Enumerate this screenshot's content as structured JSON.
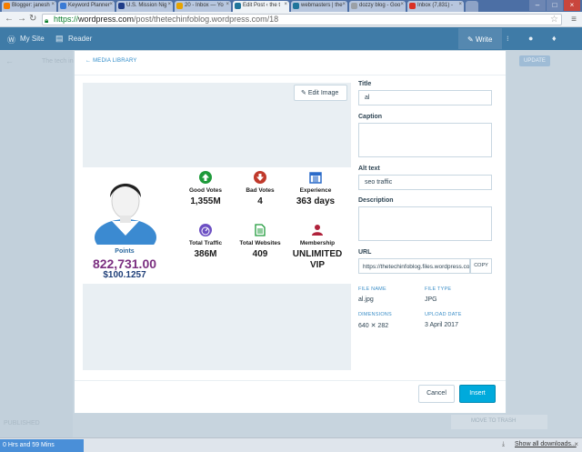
{
  "browser": {
    "tabs": [
      {
        "label": "Blogger: janesh",
        "color": "#f57d00",
        "active": false
      },
      {
        "label": "Keyword Planner",
        "color": "#3a7bd5",
        "active": false
      },
      {
        "label": "U.S. Mission Nig",
        "color": "#1f3c88",
        "active": false
      },
      {
        "label": "20 - Inbox — Yo",
        "color": "#e8a400",
        "active": false
      },
      {
        "label": "Edit Post ‹ the t",
        "color": "#21759b",
        "active": true
      },
      {
        "label": "webmasters | the",
        "color": "#21759b",
        "active": false
      },
      {
        "label": "dozzy blog - Goo",
        "color": "#9aa0a6",
        "active": false
      },
      {
        "label": "Inbox (7,831) - ",
        "color": "#d93025",
        "active": false
      }
    ],
    "url_scheme": "https://",
    "url_host": "wordpress.com",
    "url_path": "/post/thetechinfoblog.wordpress.com/18"
  },
  "masterbar": {
    "my_site": "My Site",
    "reader": "Reader",
    "write": "Write"
  },
  "background": {
    "site_name": "The tech in",
    "published": "PUBLISHED",
    "update": "UPDATE",
    "move_to_trash": "MOVE TO TRASH"
  },
  "modal": {
    "back_label": "MEDIA LIBRARY",
    "edit_image": "Edit Image",
    "image": {
      "points_label": "Points",
      "points_value": "822,731.00",
      "money_value": "$100.1257",
      "stats": [
        {
          "label": "Good Votes",
          "value": "1,355M",
          "icon": "arrow-up-circle-icon"
        },
        {
          "label": "Bad Votes",
          "value": "4",
          "icon": "arrow-down-circle-icon"
        },
        {
          "label": "Experience",
          "value": "363 days",
          "icon": "calendar-icon"
        },
        {
          "label": "Total Traffic",
          "value": "386M",
          "icon": "gauge-icon"
        },
        {
          "label": "Total Websites",
          "value": "409",
          "icon": "document-icon"
        },
        {
          "label": "Membership",
          "value": "UNLIMITED VIP",
          "icon": "person-icon"
        }
      ]
    },
    "fields": {
      "title_label": "Title",
      "title_value": "al",
      "caption_label": "Caption",
      "caption_value": "",
      "alt_label": "Alt text",
      "alt_value": "seo traffic",
      "description_label": "Description",
      "description_value": "",
      "url_label": "URL",
      "url_value": "https://thetechinfoblog.files.wordpress.com/",
      "copy_label": "COPY"
    },
    "meta": {
      "file_name_label": "FILE NAME",
      "file_name_value": "al.jpg",
      "file_type_label": "FILE TYPE",
      "file_type_value": "JPG",
      "dimensions_label": "DIMENSIONS",
      "dimensions_value": "640 ✕ 282",
      "upload_date_label": "UPLOAD DATE",
      "upload_date_value": "3 April 2017"
    },
    "cancel": "Cancel",
    "insert": "Insert"
  },
  "downloads": {
    "chip": "0 Hrs and 59 Mins",
    "show_all": "Show all downloads..."
  }
}
